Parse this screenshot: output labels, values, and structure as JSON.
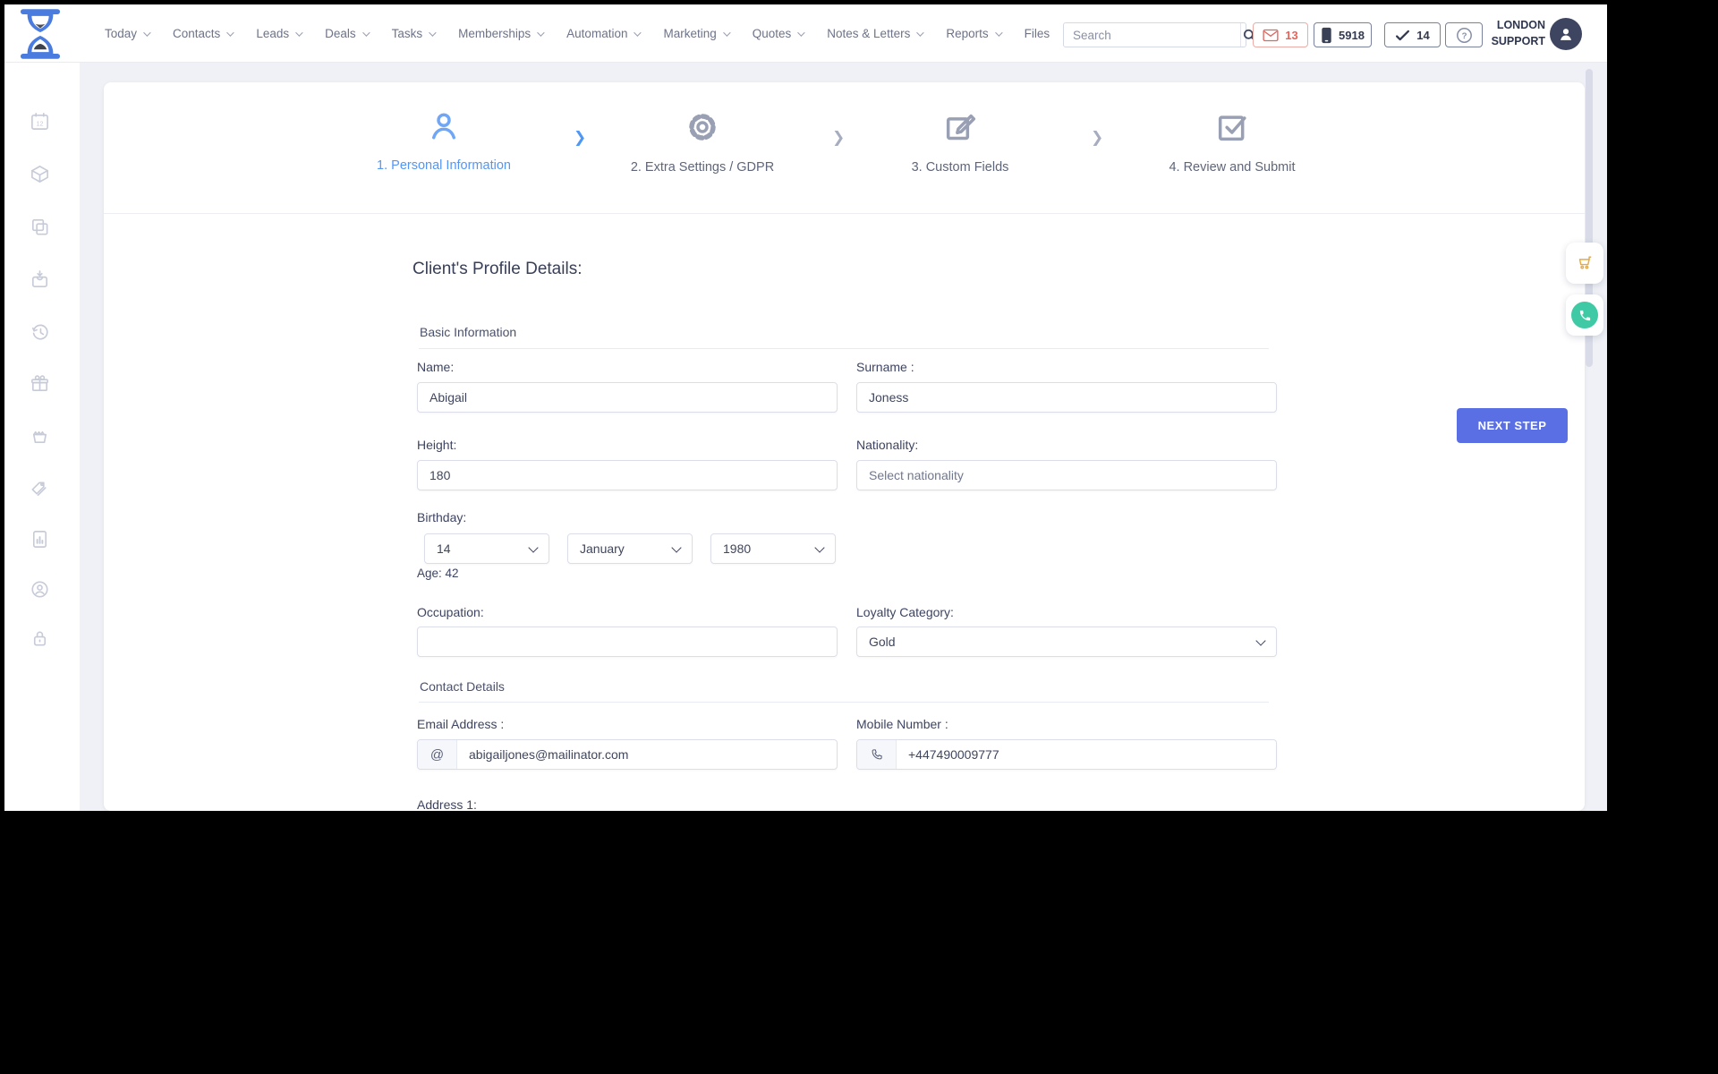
{
  "header": {
    "nav": [
      {
        "label": "Today",
        "caret": true
      },
      {
        "label": "Contacts",
        "caret": true
      },
      {
        "label": "Leads",
        "caret": true
      },
      {
        "label": "Deals",
        "caret": true
      },
      {
        "label": "Tasks",
        "caret": true
      },
      {
        "label": "Memberships",
        "caret": true
      },
      {
        "label": "Automation",
        "caret": true
      },
      {
        "label": "Marketing",
        "caret": true
      },
      {
        "label": "Quotes",
        "caret": true
      },
      {
        "label": "Notes & Letters",
        "caret": true
      },
      {
        "label": "Reports",
        "caret": true
      },
      {
        "label": "Files",
        "caret": false
      }
    ],
    "search": {
      "placeholder": "Search"
    },
    "badges": {
      "mail_count": "13",
      "phone_number": "5918",
      "tasks_count": "14",
      "help": "?"
    },
    "account": {
      "line1": "LONDON",
      "line2": "SUPPORT"
    }
  },
  "sidebar": {
    "icons": [
      "calendar",
      "products",
      "duplicates",
      "collect-box",
      "history",
      "gifts",
      "basket",
      "price-tags",
      "reports",
      "account-manager",
      "security-lock"
    ]
  },
  "wizard": {
    "steps": [
      {
        "label": "1. Personal Information",
        "icon": "user",
        "active": true
      },
      {
        "label": "2. Extra Settings / GDPR",
        "icon": "gear",
        "active": false
      },
      {
        "label": "3. Custom Fields",
        "icon": "edit",
        "active": false
      },
      {
        "label": "4. Review and Submit",
        "icon": "check",
        "active": false
      }
    ]
  },
  "form": {
    "heading": "Client's Profile Details:",
    "section_basic": "Basic Information",
    "section_contact": "Contact Details",
    "fields": {
      "name": {
        "label": "Name:",
        "value": "Abigail"
      },
      "surname": {
        "label": "Surname :",
        "value": "Joness"
      },
      "height": {
        "label": "Height:",
        "value": "180"
      },
      "nationality": {
        "label": "Nationality:",
        "placeholder": "Select nationality"
      },
      "birthday": {
        "label": "Birthday:",
        "day": "14",
        "month": "January",
        "year": "1980"
      },
      "age": "Age: 42",
      "occupation": {
        "label": "Occupation:",
        "value": ""
      },
      "loyalty": {
        "label": "Loyalty Category:",
        "value": "Gold"
      },
      "email": {
        "label": "Email Address :",
        "value": "abigailjones@mailinator.com",
        "prefix": "@"
      },
      "mobile": {
        "label": "Mobile Number :",
        "value": "+447490009777"
      },
      "address1": {
        "label": "Address 1:"
      }
    },
    "next_button": "NEXT STEP"
  },
  "colors": {
    "accent_blue": "#5596f3",
    "button_indigo": "#5a6fe4",
    "badge_red": "#e0655e",
    "whatsapp_teal": "#3fc9a4",
    "cart_orange": "#ecaa3d",
    "page_bg": "#eff1f6",
    "text_dark": "#3d4461"
  }
}
